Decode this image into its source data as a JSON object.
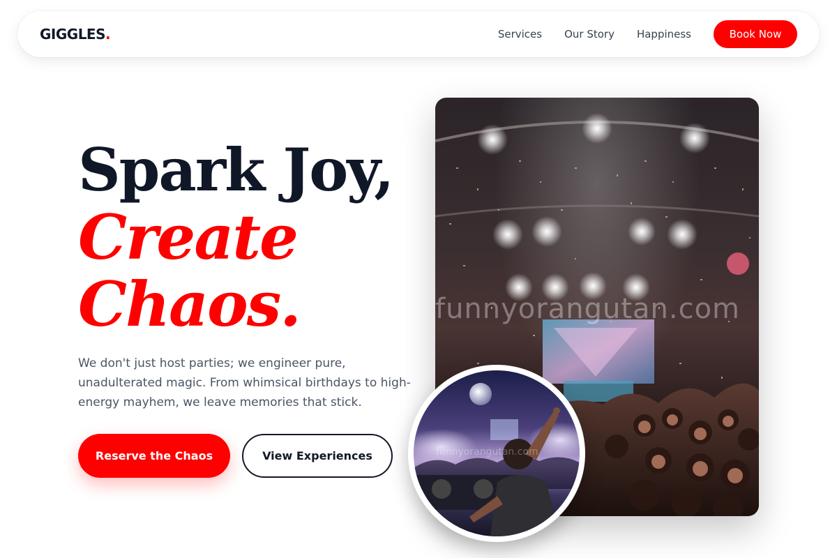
{
  "nav": {
    "logo_text": "GIGGLES",
    "logo_dot": ".",
    "links": [
      {
        "label": "Services"
      },
      {
        "label": "Our Story"
      },
      {
        "label": "Happiness"
      }
    ],
    "cta_label": "Book Now"
  },
  "hero": {
    "headline_line1": "Spark Joy,",
    "headline_line2": "Create",
    "headline_line3": "Chaos.",
    "subcopy": "We don't just host parties; we engineer pure, unadulterated magic. From whimsical birthdays to high-energy mayhem, we leave memories that stick.",
    "primary_button": "Reserve the Chaos",
    "secondary_button": "View Experiences"
  },
  "images": {
    "main_watermark": "funnyorangutan.com",
    "circle_watermark": "funnyorangutan.com"
  },
  "colors": {
    "accent": "#ff0000",
    "ink": "#101828",
    "muted": "#4b5563"
  }
}
